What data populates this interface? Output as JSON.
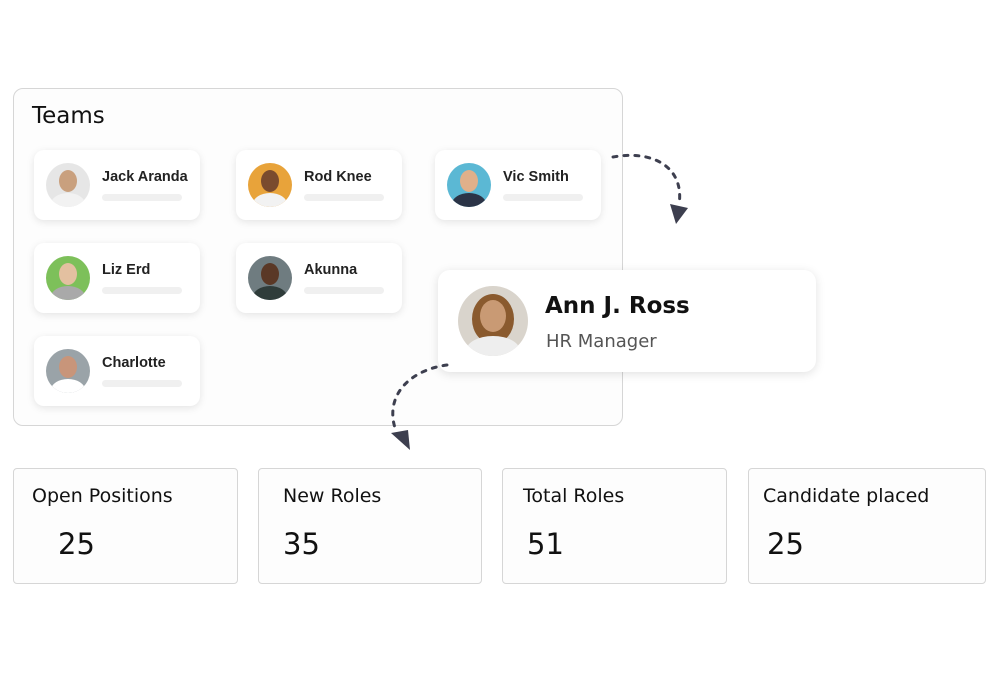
{
  "teams": {
    "title": "Teams",
    "members": [
      {
        "name": "Jack Aranda",
        "avatar_bg": "#e6e6e6",
        "skin": "#c9a07e",
        "shirt": "#f2f2f2"
      },
      {
        "name": "Rod Knee",
        "avatar_bg": "#e8a33a",
        "skin": "#7a4b2e",
        "shirt": "#f2f2f2"
      },
      {
        "name": "Vic Smith",
        "avatar_bg": "#5bb8d4",
        "skin": "#e0b08a",
        "shirt": "#2b3447"
      },
      {
        "name": "Liz Erd",
        "avatar_bg": "#7dc05a",
        "skin": "#e3c0a0",
        "shirt": "#a9a9a9"
      },
      {
        "name": "Akunna",
        "avatar_bg": "#6f7c80",
        "skin": "#5a3826",
        "shirt": "#2f3c3a"
      },
      {
        "name": "Charlotte",
        "avatar_bg": "#9aa3a8",
        "skin": "#c8957a",
        "shirt": "#ffffff"
      }
    ]
  },
  "highlight": {
    "name": "Ann J. Ross",
    "role": "HR Manager"
  },
  "stats": [
    {
      "label": "Open Positions",
      "value": "25"
    },
    {
      "label": "New Roles",
      "value": "35"
    },
    {
      "label": "Total Roles",
      "value": "51"
    },
    {
      "label": "Candidate placed",
      "value": "25"
    }
  ],
  "colors": {
    "arrow": "#3d3f4f",
    "border": "#d6d6d6"
  }
}
